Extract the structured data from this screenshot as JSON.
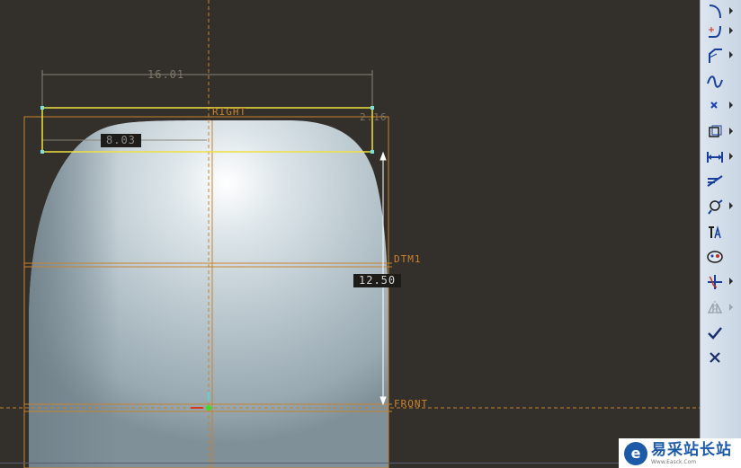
{
  "viewport": {
    "dimension_width": "16.01",
    "dimension_half": "8.03",
    "dimension_height": "12.50",
    "dimension_small": "2.16",
    "datum_right": "RIGHT",
    "datum_dtm1": "DTM1",
    "datum_front": "FRONT"
  },
  "colors": {
    "background": "#33302b",
    "datum_orange": "#c9822e",
    "selection_yellow": "#f0e040",
    "model_blue_grey": "#b9c7cf",
    "toolbar": "#d4dee9"
  },
  "toolbar": {
    "tools": [
      {
        "name": "arc-icon",
        "has_flyout": true
      },
      {
        "name": "fillet-icon",
        "has_flyout": true
      },
      {
        "name": "chamfer-icon",
        "has_flyout": true
      },
      {
        "name": "spline-icon",
        "has_flyout": false
      },
      {
        "name": "point-icon",
        "has_flyout": true
      },
      {
        "name": "offset-icon",
        "has_flyout": true
      },
      {
        "name": "dimension-icon",
        "has_flyout": true
      },
      {
        "name": "modify-icon",
        "has_flyout": false
      },
      {
        "name": "constraint-icon",
        "has_flyout": true
      },
      {
        "name": "text-icon",
        "has_flyout": false
      },
      {
        "name": "palette-icon",
        "has_flyout": false
      },
      {
        "name": "trim-icon",
        "has_flyout": true
      },
      {
        "name": "mirror-icon",
        "has_flyout": true
      },
      {
        "name": "accept-icon",
        "has_flyout": false
      },
      {
        "name": "cancel-icon",
        "has_flyout": false
      }
    ]
  },
  "watermark": {
    "name": "易采站长站",
    "url": "Www.Easck.Com",
    "logo_letter": "e"
  }
}
